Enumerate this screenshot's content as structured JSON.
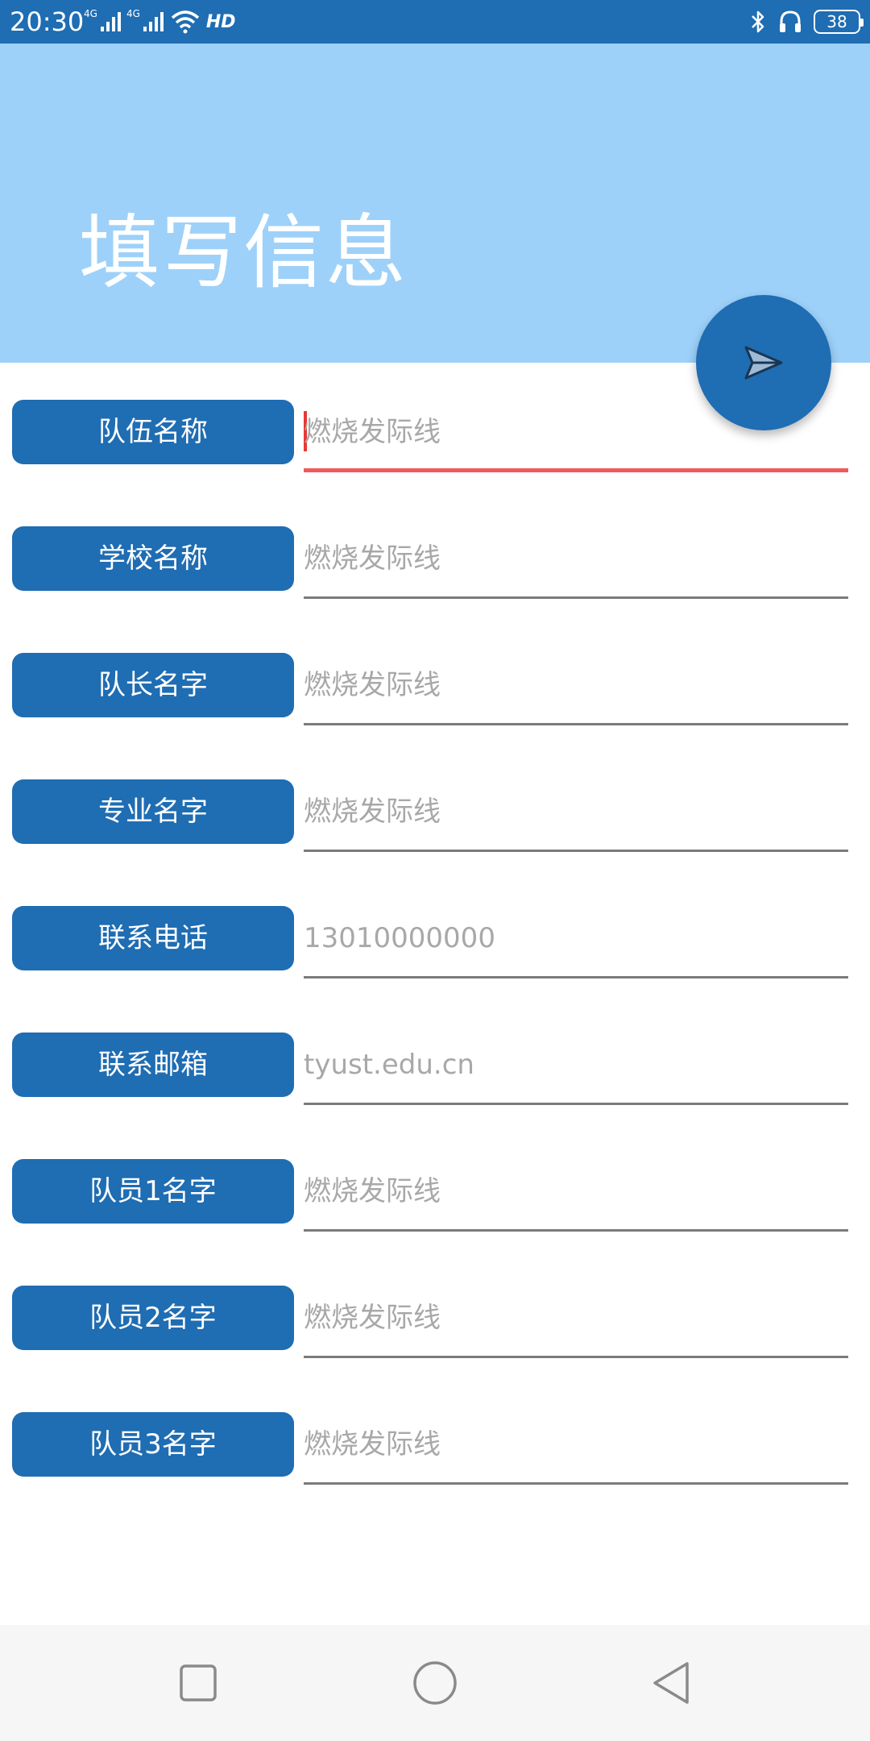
{
  "status_bar": {
    "time": "20:30",
    "signal_1": "4G",
    "signal_2": "4G",
    "hd": "HD",
    "battery": "38"
  },
  "header": {
    "title": "填写信息"
  },
  "fab": {
    "icon": "send-icon"
  },
  "form": {
    "rows": [
      {
        "label": "队伍名称",
        "placeholder": "燃烧发际线"
      },
      {
        "label": "学校名称",
        "placeholder": "燃烧发际线"
      },
      {
        "label": "队长名字",
        "placeholder": "燃烧发际线"
      },
      {
        "label": "专业名字",
        "placeholder": "燃烧发际线"
      },
      {
        "label": "联系电话",
        "placeholder": "13010000000"
      },
      {
        "label": "联系邮箱",
        "placeholder": "tyust.edu.cn"
      },
      {
        "label": "队员1名字",
        "placeholder": "燃烧发际线"
      },
      {
        "label": "队员2名字",
        "placeholder": "燃烧发际线"
      },
      {
        "label": "队员3名字",
        "placeholder": "燃烧发际线"
      }
    ]
  },
  "nav": {
    "recent": "square-icon",
    "home": "circle-icon",
    "back": "triangle-back-icon"
  },
  "colors": {
    "primary": "#1f6db3",
    "header_bg": "#9dd1f9",
    "focus_underline": "#f05a5a",
    "underline": "#7b7b7b",
    "placeholder": "#a8a8a8"
  }
}
